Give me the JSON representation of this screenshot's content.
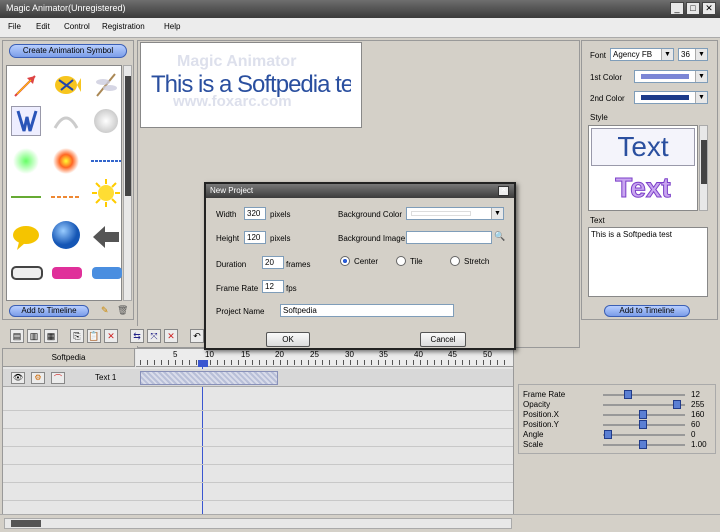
{
  "window": {
    "title": "Magic Animator(Unregistered)"
  },
  "menu": [
    "File",
    "Edit",
    "Control",
    "Registration",
    "Help"
  ],
  "left": {
    "create_button": "Create Animation Symbol",
    "add_button": "Add to Timeline"
  },
  "stage": {
    "watermark1": "Magic Animator",
    "watermark2": "www.foxarc.com",
    "text": "This is a Softpedia test"
  },
  "right": {
    "font_label": "Font",
    "font_value": "Agency FB",
    "size_value": "36",
    "color1_label": "1st Color",
    "color2_label": "2nd Color",
    "style_label": "Style",
    "style_sample1": "Text",
    "style_sample2": "Text",
    "text_label": "Text",
    "text_value": "This is a Softpedia test",
    "add_button": "Add to Timeline",
    "color1": "#7b86d6",
    "color2": "#1c3b8a"
  },
  "timeline": {
    "layer_header": "Softpedia",
    "layer_name": "Text 1",
    "ticks": [
      "5",
      "10",
      "15",
      "20",
      "25",
      "30",
      "35",
      "40",
      "45",
      "50"
    ]
  },
  "props": [
    {
      "label": "Frame Rate",
      "value": "12",
      "level": 0.28
    },
    {
      "label": "Opacity",
      "value": "255",
      "level": 0.94
    },
    {
      "label": "Position.X",
      "value": "160",
      "level": 0.48
    },
    {
      "label": "Position.Y",
      "value": "60",
      "level": 0.48
    },
    {
      "label": "Angle",
      "value": "0",
      "level": 0.02
    },
    {
      "label": "Scale",
      "value": "1.00",
      "level": 0.48
    }
  ],
  "dialog": {
    "title": "New Project",
    "width_label": "Width",
    "width_value": "320",
    "width_unit": "pixels",
    "height_label": "Height",
    "height_value": "120",
    "height_unit": "pixels",
    "duration_label": "Duration",
    "duration_value": "20",
    "duration_unit": "frames",
    "framerate_label": "Frame Rate",
    "framerate_value": "12",
    "framerate_unit": "fps",
    "bgcolor_label": "Background Color",
    "bgimage_label": "Background Image",
    "radio_center": "Center",
    "radio_tile": "Tile",
    "radio_stretch": "Stretch",
    "project_label": "Project Name",
    "project_value": "Softpedia",
    "ok": "OK",
    "cancel": "Cancel"
  }
}
